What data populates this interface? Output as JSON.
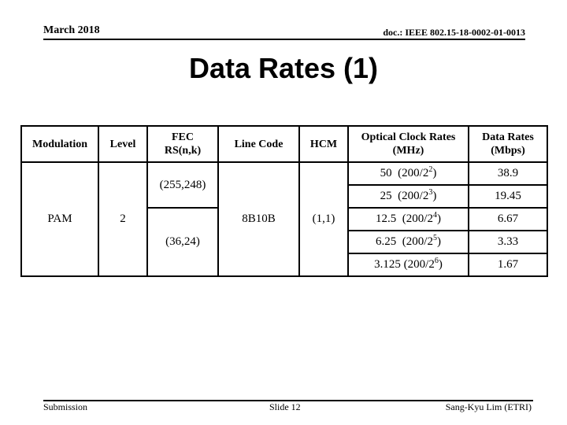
{
  "header": {
    "date": "March 2018",
    "doc_id": "doc.: IEEE 802.15-18-0002-01-0013"
  },
  "title": "Data Rates (1)",
  "table": {
    "columns": {
      "modulation": "Modulation",
      "level": "Level",
      "fec_line1": "FEC",
      "fec_line2": "RS(n,k)",
      "line_code": "Line Code",
      "hcm": "HCM",
      "clock_line1": "Optical Clock Rates",
      "clock_line2": "(MHz)",
      "data_line1": "Data Rates",
      "data_line2": "(Mbps)"
    },
    "modulation": "PAM",
    "level": "2",
    "fec": [
      "(255,248)",
      "(36,24)"
    ],
    "line_code": "8B10B",
    "hcm": "(1,1)",
    "rows": [
      {
        "clock": "50",
        "divisor_base": "(200/2",
        "exponent": "2",
        "close": ")",
        "data_rate": "38.9"
      },
      {
        "clock": "25",
        "divisor_base": "(200/2",
        "exponent": "3",
        "close": ")",
        "data_rate": "19.45"
      },
      {
        "clock": "12.5",
        "divisor_base": "(200/2",
        "exponent": "4",
        "close": ")",
        "data_rate": "6.67"
      },
      {
        "clock": "6.25",
        "divisor_base": "(200/2",
        "exponent": "5",
        "close": ")",
        "data_rate": "3.33"
      },
      {
        "clock": "3.125",
        "divisor_base": "(200/2",
        "exponent": "6",
        "close": ")",
        "data_rate": "1.67"
      }
    ]
  },
  "footer": {
    "left": "Submission",
    "center": "Slide 12",
    "right": "Sang-Kyu Lim (ETRI)"
  }
}
